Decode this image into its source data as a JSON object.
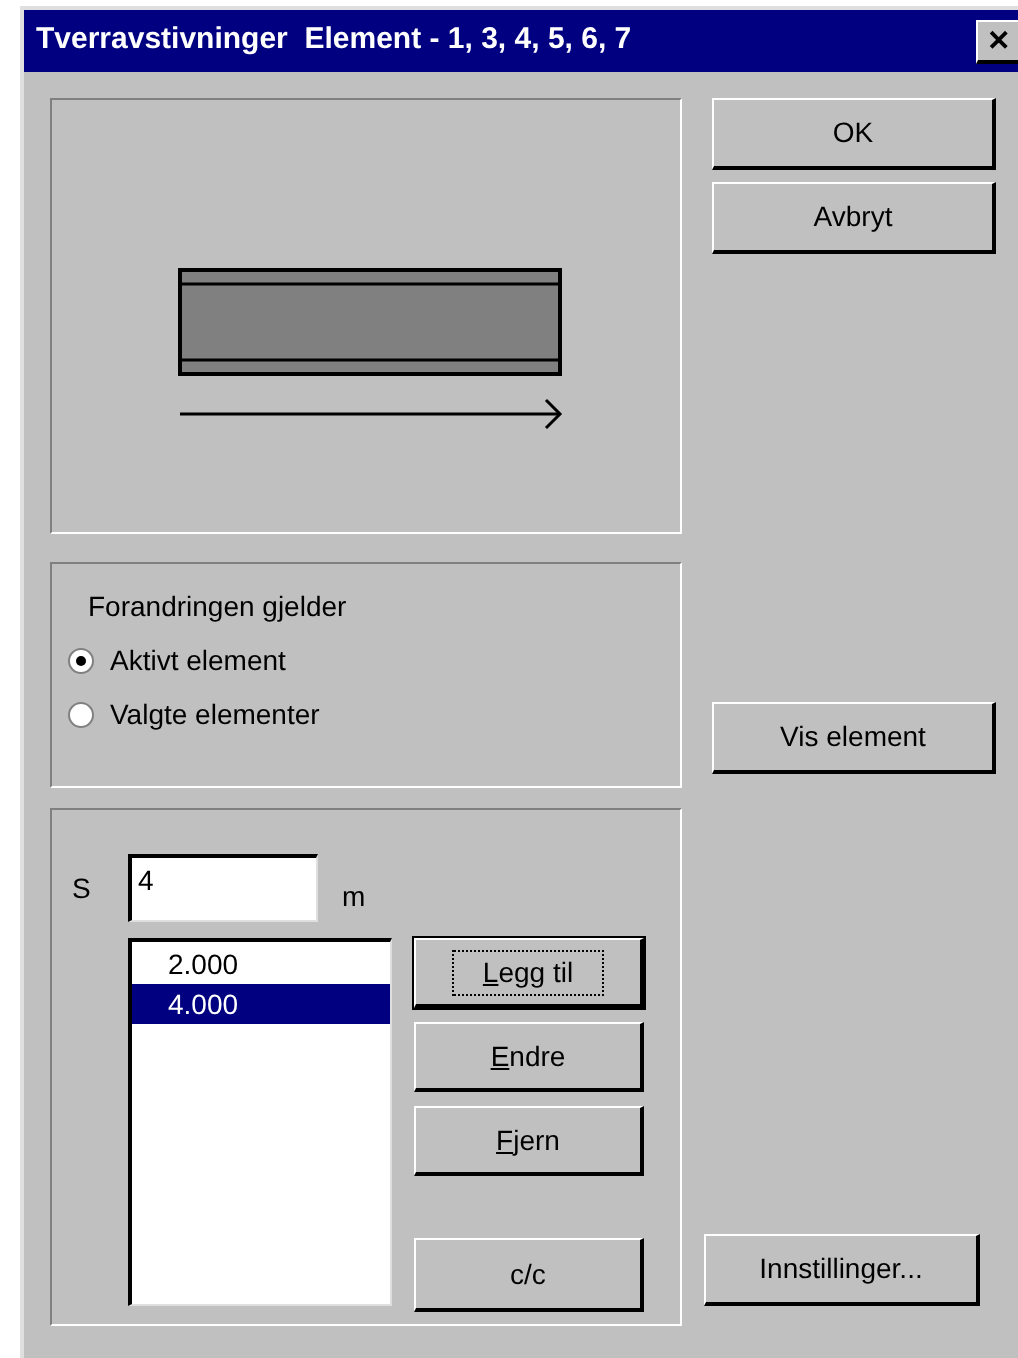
{
  "window": {
    "title": "Tverravstivninger  Element - 1, 3, 4, 5, 6, 7",
    "close": "✕"
  },
  "buttons_top": [
    {
      "label": "OK"
    },
    {
      "label": "Avbryt"
    }
  ],
  "scope_group": {
    "title": "Forandringen gjelder",
    "options": [
      {
        "label": "Aktivt element",
        "selected": true
      },
      {
        "label": "Valgte elementer",
        "selected": false
      }
    ]
  },
  "show_button": {
    "label": "Vis element"
  },
  "spacing": {
    "label": "S",
    "value": "4",
    "unit": "m",
    "list": [
      {
        "text": "2.000",
        "selected": false
      },
      {
        "text": "4.000",
        "selected": true
      }
    ],
    "buttons": [
      {
        "label": "Legg til",
        "underline_first": true,
        "default": true
      },
      {
        "label": "Endre",
        "underline_first": true,
        "default": false
      },
      {
        "label": "Fjern",
        "underline_first": true,
        "default": false
      }
    ],
    "cc_button": {
      "label": "c/c"
    }
  },
  "settings_button": {
    "label": "Innstillinger..."
  }
}
